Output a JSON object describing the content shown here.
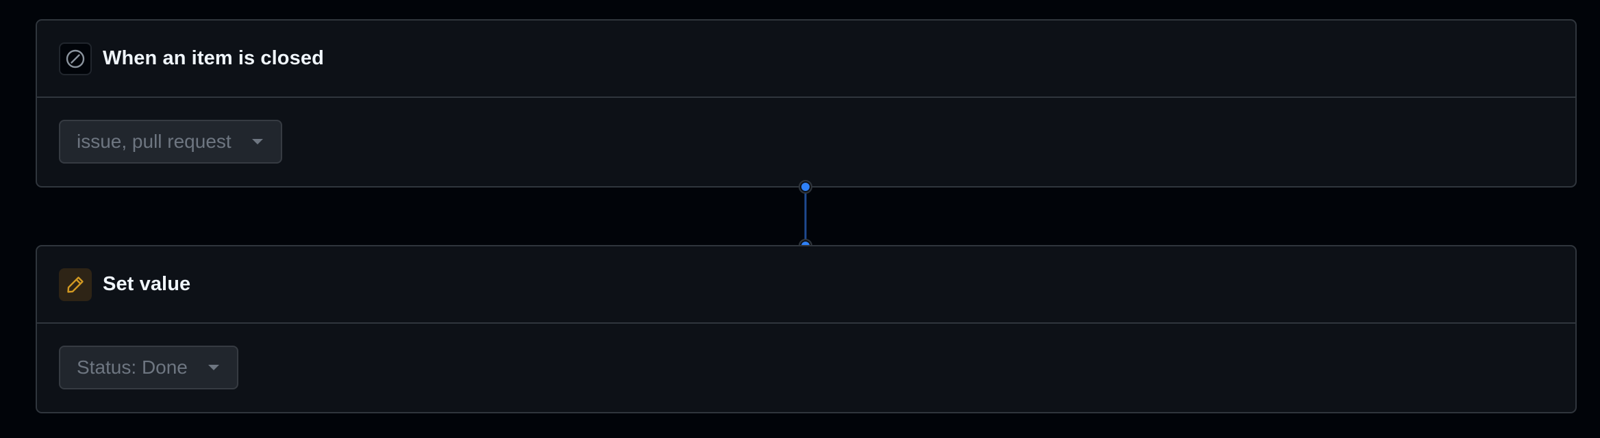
{
  "trigger": {
    "title": "When an item is closed",
    "icon": "slash-circle-icon",
    "select_value": "issue, pull request"
  },
  "action": {
    "title": "Set value",
    "icon": "pencil-icon",
    "select_value": "Status: Done"
  },
  "colors": {
    "background": "#010409",
    "card": "#0d1117",
    "border": "#30363d",
    "connector": "#1f6feb",
    "attention": "#d29922"
  }
}
